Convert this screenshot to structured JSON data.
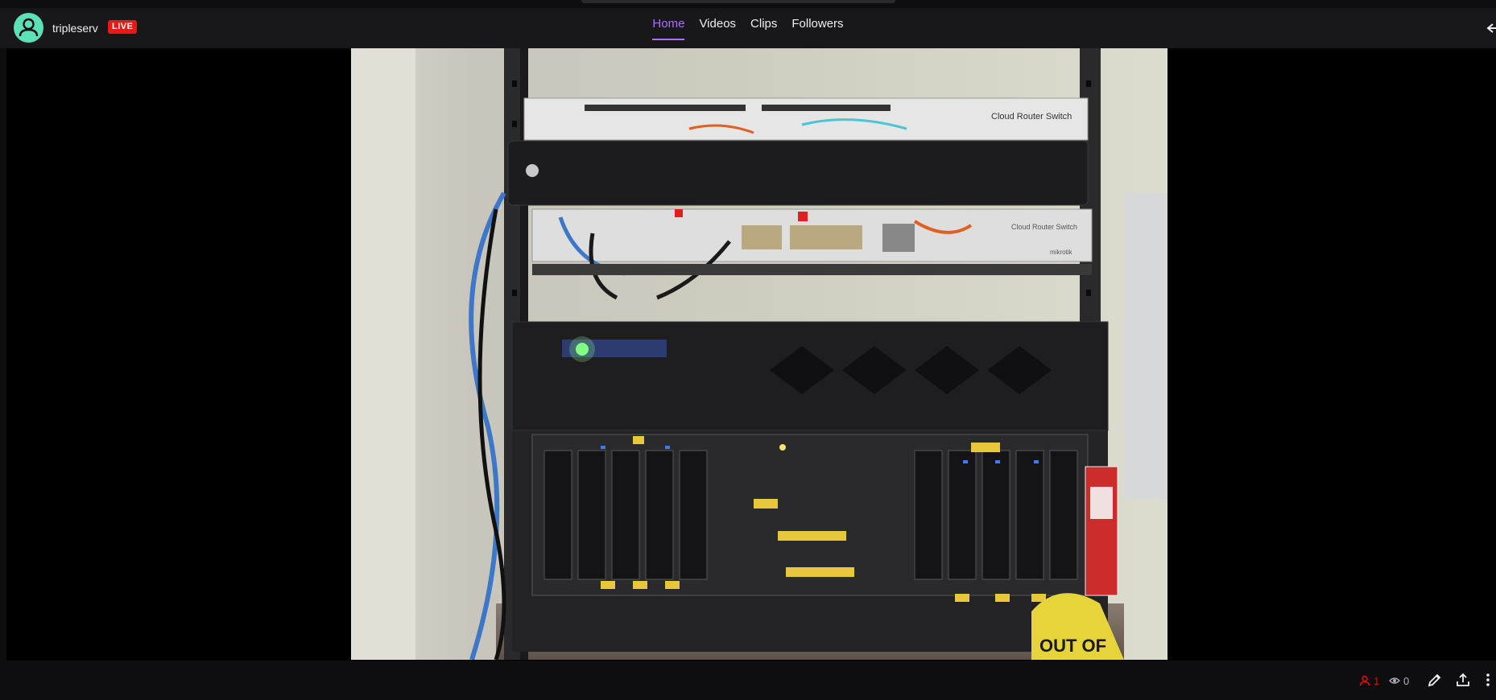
{
  "channel": {
    "name": "tripleserv",
    "live_label": "LIVE",
    "avatar_color": "#5ce0b5"
  },
  "nav": {
    "tabs": [
      {
        "label": "Home",
        "active": true
      },
      {
        "label": "Videos",
        "active": false
      },
      {
        "label": "Clips",
        "active": false
      },
      {
        "label": "Followers",
        "active": false
      }
    ]
  },
  "player": {
    "content": "webcam stream of server rack",
    "rack_labels": {
      "switch_top": "Cloud Router Switch",
      "switch_bottom": "Cloud Router Switch",
      "brand": "mikrotik",
      "tag": "OUT OF"
    }
  },
  "stats": {
    "viewers": "1",
    "views": "0"
  },
  "colors": {
    "accent": "#a970ff",
    "live": "#e91916",
    "viewer_red": "#eb0400"
  },
  "icons": {
    "viewer": "person-icon",
    "views": "eye-icon",
    "edit": "pencil-icon",
    "share": "share-icon",
    "more": "more-vertical-icon",
    "collapse": "arrow-left-icon"
  }
}
